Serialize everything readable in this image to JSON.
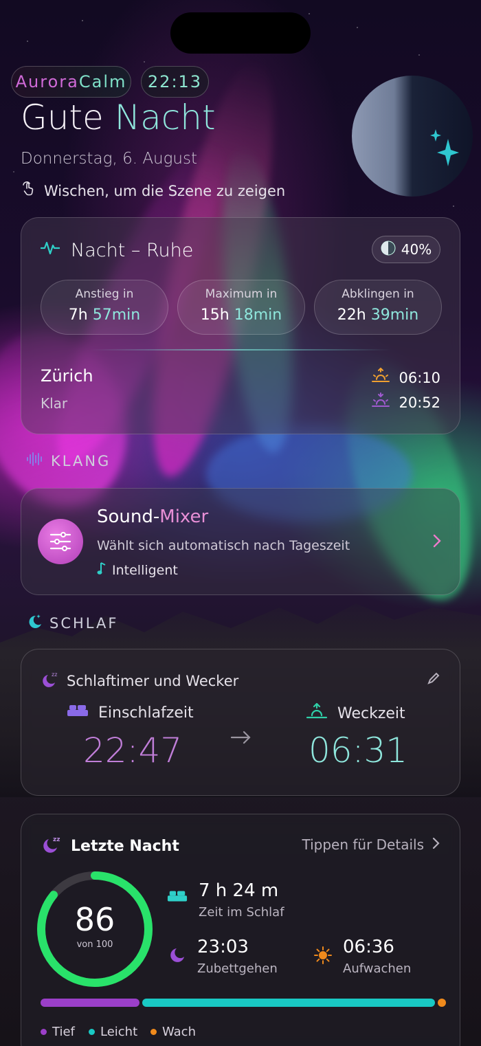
{
  "header": {
    "brand_a": "Aurora",
    "brand_b": "Calm",
    "time": "22:13",
    "greeting_a": "Gute",
    "greeting_b": "Nacht",
    "date": "Donnerstag, 6. August",
    "hint": "Wischen, um die Szene zu zeigen"
  },
  "aurora": {
    "title": "Nacht – Ruhe",
    "intensity": "40%",
    "stats": [
      {
        "label": "Anstieg in",
        "h": "7h",
        "m": "57min"
      },
      {
        "label": "Maximum in",
        "h": "15h",
        "m": "18min"
      },
      {
        "label": "Abklingen in",
        "h": "22h",
        "m": "39min"
      }
    ],
    "city": "Zürich",
    "condition": "Klar",
    "sunrise": "06:10",
    "sunset": "20:52"
  },
  "section_sound": "KLANG",
  "mixer": {
    "title_a": "Sound-",
    "title_b": "Mixer",
    "subtitle": "Wählt sich automatisch nach Tageszeit",
    "tag": "Intelligent"
  },
  "section_sleep": "SCHLAF",
  "timer": {
    "title": "Schlaftimer und Wecker",
    "bed_label": "Einschlafzeit",
    "bed_time": "22:47",
    "wake_label": "Weckzeit",
    "wake_time": "06:31"
  },
  "last_night": {
    "title": "Letzte Nacht",
    "details": "Tippen für Details",
    "score": "86",
    "score_of": "von 100",
    "sleep_time": "7 h 24 m",
    "sleep_time_label": "Zeit im Schlaf",
    "bedtime": "23:03",
    "bedtime_label": "Zubettgehen",
    "wakeup": "06:36",
    "wakeup_label": "Aufwachen",
    "legend": [
      "Tief",
      "Leicht",
      "Wach"
    ],
    "colors": {
      "deep": "#9b3fc9",
      "light": "#19c9c4",
      "awake": "#f08a1c"
    }
  }
}
